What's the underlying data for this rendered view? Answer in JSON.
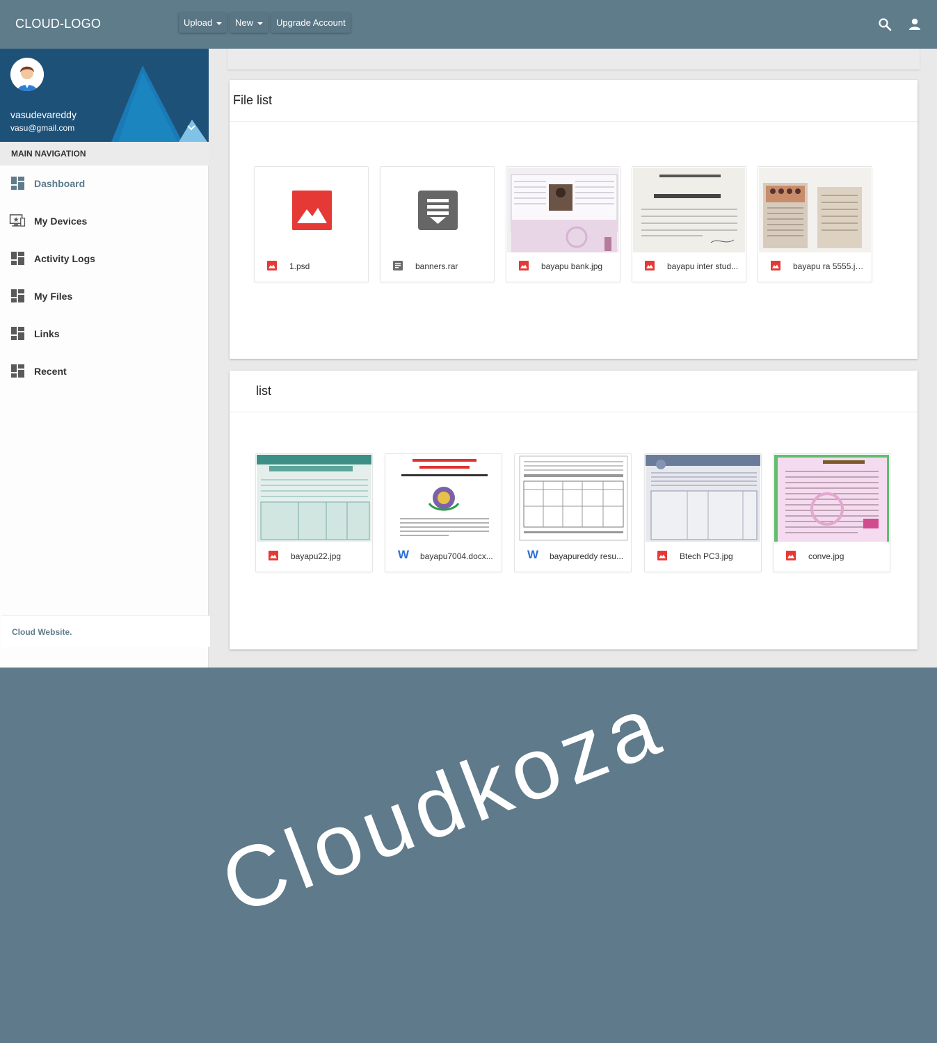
{
  "header": {
    "logo": "CLOUD-LOGO",
    "upload_label": "Upload",
    "new_label": "New",
    "upgrade_label": "Upgrade Account"
  },
  "profile": {
    "name": "vasudevareddy",
    "email": "vasu@gmail.com"
  },
  "sidebar": {
    "heading": "MAIN NAVIGATION",
    "items": [
      {
        "label": "Dashboard",
        "icon": "dashboard-icon",
        "active": true
      },
      {
        "label": "My Devices",
        "icon": "monitor-icon"
      },
      {
        "label": "Activity Logs",
        "icon": "dashboard-icon"
      },
      {
        "label": "My Files",
        "icon": "dashboard-icon"
      },
      {
        "label": "Links",
        "icon": "dashboard-icon"
      },
      {
        "label": "Recent",
        "icon": "dashboard-icon"
      }
    ],
    "footer": "Cloud Website."
  },
  "panels": [
    {
      "title": "File list",
      "files": [
        {
          "name": "1.psd",
          "icon": "image-icon"
        },
        {
          "name": "banners.rar",
          "icon": "archive-icon"
        },
        {
          "name": "bayapu bank.jpg",
          "icon": "image-icon"
        },
        {
          "name": "bayapu inter stud...",
          "icon": "image-icon"
        },
        {
          "name": "bayapu ra 5555.jp...",
          "icon": "image-icon"
        }
      ]
    },
    {
      "title": "list",
      "files": [
        {
          "name": "bayapu22.jpg",
          "icon": "image-icon"
        },
        {
          "name": "bayapu7004.docx...",
          "icon": "word-icon"
        },
        {
          "name": "bayapureddy resu...",
          "icon": "word-icon"
        },
        {
          "name": "Btech PC3.jpg",
          "icon": "image-icon"
        },
        {
          "name": "conve.jpg",
          "icon": "image-icon"
        }
      ]
    }
  ],
  "colors": {
    "header_bg": "#5f7c8b",
    "profile_bg": "#1e5178",
    "image_icon": "#e53935",
    "archive_icon": "#6b6b6b",
    "word_icon": "#2b6fd6"
  },
  "watermark": "Cloudkoza"
}
